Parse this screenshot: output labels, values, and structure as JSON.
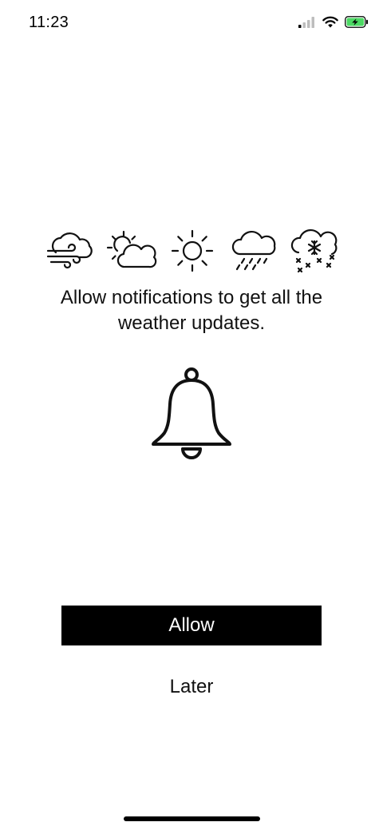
{
  "status_bar": {
    "time": "11:23",
    "icons": [
      "cellular-signal-icon",
      "wifi-icon",
      "battery-charging-icon"
    ],
    "battery_color": "#4CD964"
  },
  "weather_icons": [
    "windy-cloud-icon",
    "partly-sunny-icon",
    "sun-icon",
    "rain-cloud-icon",
    "snow-cloud-icon"
  ],
  "message": "Allow notifications to get all the weather updates.",
  "main_icon": "bell-icon",
  "buttons": {
    "allow_label": "Allow",
    "later_label": "Later"
  },
  "colors": {
    "primary_button_bg": "#000000",
    "primary_button_text": "#FFFFFF",
    "text": "#111111"
  }
}
